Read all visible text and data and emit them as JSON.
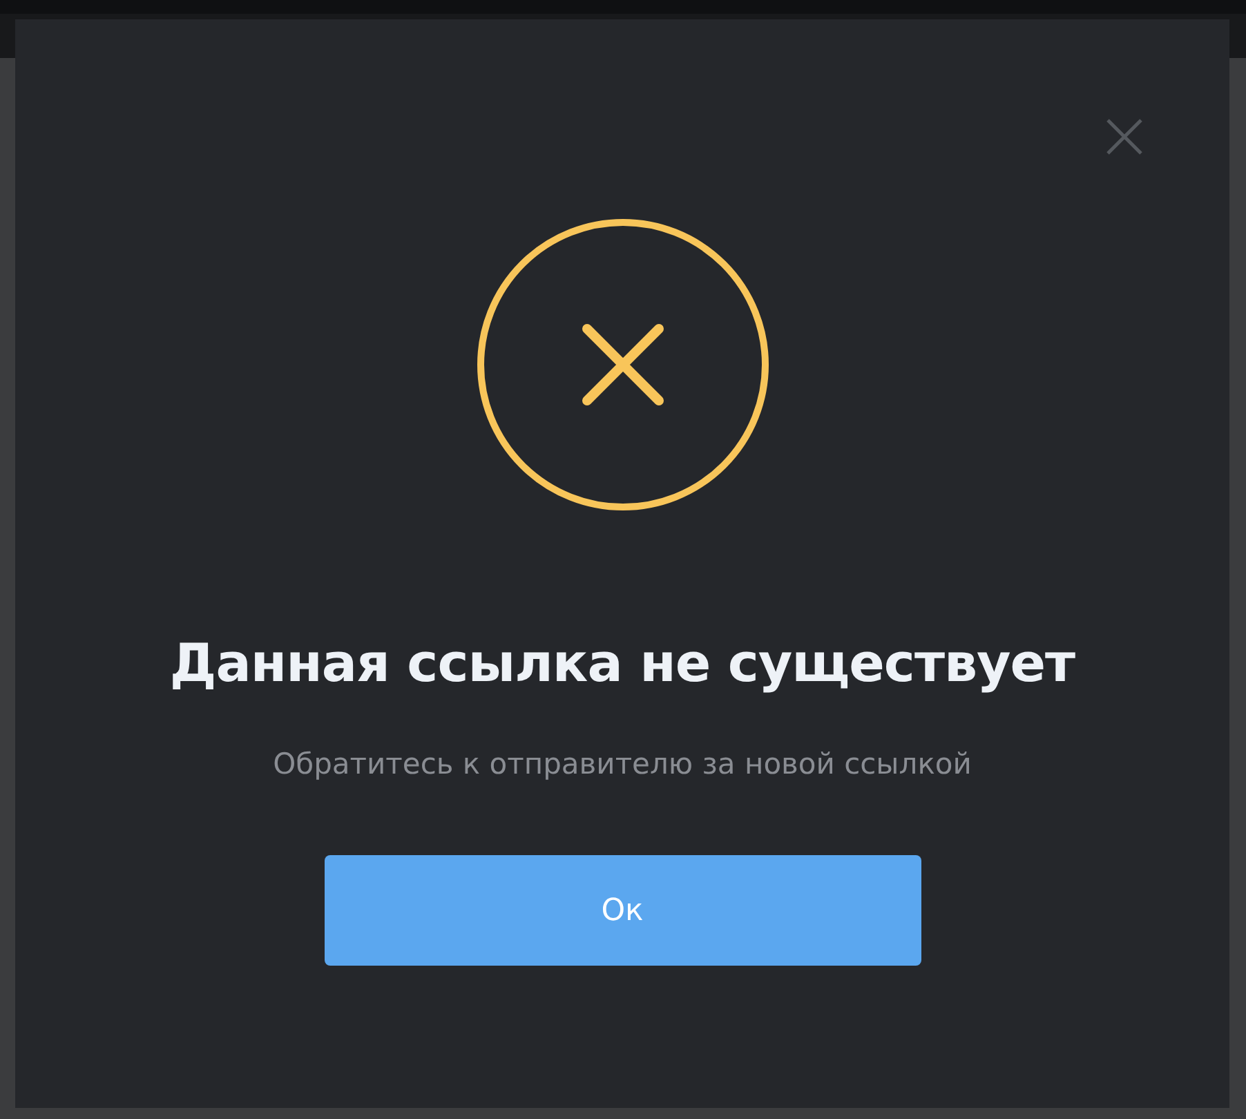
{
  "dialog": {
    "title": "Данная ссылка не существует",
    "message": "Обратитесь к отправителю за новой ссылкой",
    "button": "Ок"
  }
}
